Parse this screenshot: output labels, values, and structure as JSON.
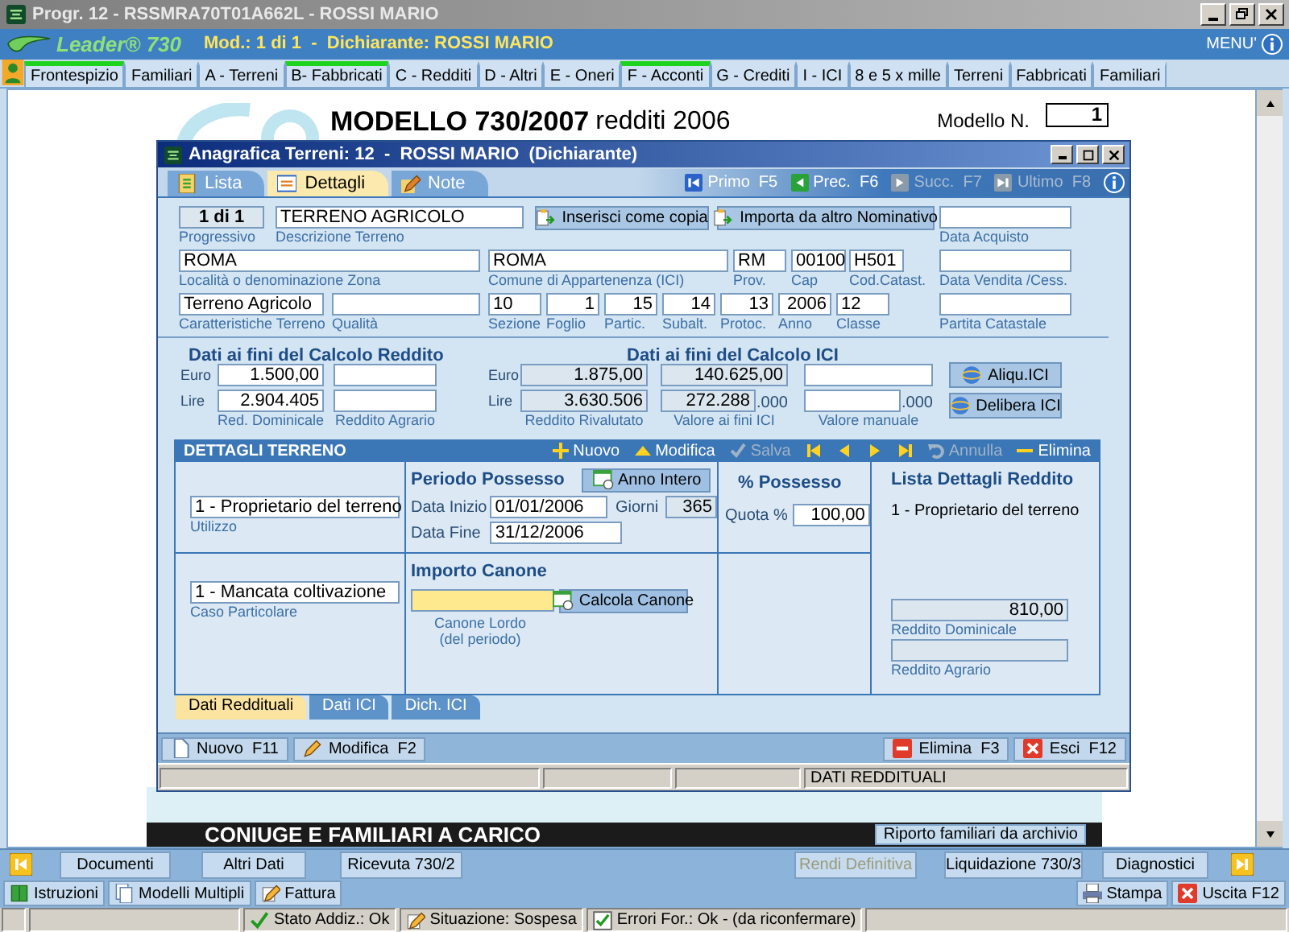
{
  "window": {
    "title": "Progr. 12 - RSSMRA70T01A662L - ROSSI MARIO"
  },
  "header": {
    "logo": "Leader® 730",
    "info": "Mod.: 1 di 1  -  Dichiarante: ROSSI MARIO",
    "menu": "MENU'"
  },
  "main_tabs": [
    {
      "label": "Frontespizio",
      "flagged": true
    },
    {
      "label": "Familiari",
      "flagged": false
    },
    {
      "label": "A - Terreni",
      "flagged": false
    },
    {
      "label": "B- Fabbricati",
      "flagged": true
    },
    {
      "label": "C - Redditi",
      "flagged": false
    },
    {
      "label": "D - Altri",
      "flagged": false
    },
    {
      "label": "E - Oneri",
      "flagged": false
    },
    {
      "label": "F - Acconti",
      "flagged": true
    },
    {
      "label": "G - Crediti",
      "flagged": false
    },
    {
      "label": "I - ICI",
      "flagged": false
    },
    {
      "label": "8 e 5 x mille",
      "flagged": false
    },
    {
      "label": "Terreni",
      "flagged": false
    },
    {
      "label": "Fabbricati",
      "flagged": false
    },
    {
      "label": "Familiari",
      "flagged": false
    }
  ],
  "document": {
    "title": "MODELLO 730/2007",
    "subtitle": "redditi 2006",
    "number_label": "Modello N.",
    "number": "1",
    "section_title": "CONIUGE E FAMILIARI A CARICO",
    "section_button": "Riporto familiari da archivio"
  },
  "dialog": {
    "title": "Anagrafica Terreni: 12  -  ROSSI MARIO  (Dichiarante)",
    "tabs": [
      {
        "label": "Lista",
        "selected": false
      },
      {
        "label": "Dettagli",
        "selected": true
      },
      {
        "label": "Note",
        "selected": false
      }
    ],
    "record_nav": [
      {
        "kind": "first",
        "label": "Primo  F5",
        "disabled": false
      },
      {
        "kind": "prev",
        "label": "Prec.  F6",
        "disabled": false
      },
      {
        "kind": "next",
        "label": "Succ.  F7",
        "disabled": true
      },
      {
        "kind": "last",
        "label": "Ultimo  F8",
        "disabled": true
      }
    ],
    "fields": [
      {
        "kind": "counter",
        "value": "1 di 1",
        "label": "Progressivo"
      },
      {
        "kind": "text",
        "value": "TERRENO AGRICOLO",
        "label": "Descrizione Terreno"
      },
      {
        "kind": "button",
        "label": "Inserisci come copia"
      },
      {
        "kind": "button",
        "label": "Importa da altro Nominativo"
      },
      {
        "kind": "text",
        "label": "Data Acquisto"
      },
      {
        "kind": "text",
        "value": "ROMA",
        "label": "Località o denominazione Zona"
      },
      {
        "kind": "text",
        "value": "ROMA",
        "label": "Comune di Appartenenza (ICI)"
      },
      {
        "kind": "text",
        "value": "RM",
        "label": "Prov."
      },
      {
        "kind": "text",
        "value": "00100",
        "label": "Cap"
      },
      {
        "kind": "text",
        "value": "H501",
        "label": "Cod.Catast."
      },
      {
        "kind": "text",
        "label": "Data Vendita /Cess."
      },
      {
        "kind": "text",
        "value": "Terreno Agricolo",
        "label": "Caratteristiche Terreno"
      },
      {
        "kind": "text",
        "label": "Qualità"
      },
      {
        "kind": "text",
        "value": "10",
        "label": "Sezione"
      },
      {
        "kind": "number",
        "value": "1",
        "label": "Foglio"
      },
      {
        "kind": "number",
        "value": "15",
        "label": "Partic."
      },
      {
        "kind": "number",
        "value": "14",
        "label": "Subalt."
      },
      {
        "kind": "number",
        "value": "13",
        "label": "Protoc."
      },
      {
        "kind": "number",
        "value": "2006",
        "label": "Anno"
      },
      {
        "kind": "text",
        "value": "12",
        "label": "Classe"
      },
      {
        "kind": "text",
        "label": "Partita Catastale"
      }
    ],
    "reddito": {
      "title": "Dati ai fini del Calcolo Reddito",
      "euro_label": "Euro",
      "lire_label": "Lire",
      "columns": [
        {
          "kind": "number",
          "euro": "1.500,00",
          "lire": "2.904.405",
          "label": "Red. Dominicale"
        },
        {
          "kind": "number",
          "label": "Reddito Agrario"
        }
      ]
    },
    "ici": {
      "title": "Dati ai fini del Calcolo ICI",
      "euro_label": "Euro",
      "lire_label": "Lire",
      "columns": [
        {
          "kind": "readonly",
          "euro": "1.875,00",
          "lire": "3.630.506",
          "label": "Reddito Rivalutato"
        },
        {
          "kind": "readonly",
          "euro": "140.625,00",
          "lire": "272.288",
          "lire_suffix": ".000",
          "label": "Valore ai fini ICI"
        },
        {
          "kind": "number",
          "lire_suffix": ".000",
          "label": "Valore manuale"
        }
      ],
      "buttons": [
        "Aliqu.ICI",
        "Delibera ICI"
      ]
    },
    "details": {
      "title": "DETTAGLI TERRENO",
      "actions": [
        {
          "kind": "add",
          "label": "Nuovo",
          "disabled": false
        },
        {
          "kind": "edit",
          "label": "Modifica",
          "disabled": false
        },
        {
          "kind": "save",
          "label": "Salva",
          "disabled": true
        },
        {
          "kind": "first",
          "disabled": false
        },
        {
          "kind": "prev",
          "disabled": false
        },
        {
          "kind": "next",
          "disabled": false
        },
        {
          "kind": "last",
          "disabled": false
        },
        {
          "kind": "undo",
          "label": "Annulla",
          "disabled": true
        },
        {
          "kind": "delete",
          "label": "Elimina",
          "disabled": false
        }
      ],
      "utilizzo": {
        "value": "1 - Proprietario del terreno",
        "label": "Utilizzo"
      },
      "caso": {
        "value": "1 - Mancata coltivazione",
        "label": "Caso Particolare"
      },
      "periodo": {
        "title": "Periodo Possesso",
        "button": "Anno Intero",
        "start_label": "Data Inizio",
        "start": "01/01/2006",
        "days_label": "Giorni",
        "days": "365",
        "end_label": "Data Fine",
        "end": "31/12/2006"
      },
      "canone": {
        "title": "Importo Canone",
        "button": "Calcola Canone",
        "label_1": "Canone Lordo",
        "label_2": "(del periodo)"
      },
      "possesso": {
        "title": "% Possesso",
        "quota_label": "Quota %",
        "quota": "100,00"
      },
      "lista": {
        "title": "Lista Dettagli Reddito",
        "items": [
          "1 - Proprietario del terreno"
        ],
        "dominicale": "810,00",
        "dominicale_label": "Reddito Dominicale",
        "agrario_label": "Reddito Agrario"
      }
    },
    "bottom_tabs": [
      {
        "label": "Dati Reddituali",
        "selected": true
      },
      {
        "label": "Dati ICI",
        "selected": false
      },
      {
        "label": "Dich. ICI",
        "selected": false
      }
    ],
    "footer_left": [
      {
        "kind": "new",
        "label": "Nuovo  F11"
      },
      {
        "kind": "edit",
        "label": "Modifica  F2"
      }
    ],
    "footer_right": [
      {
        "kind": "delete",
        "label": "Elimina  F3"
      },
      {
        "kind": "close",
        "label": "Esci  F12"
      }
    ],
    "status_text": "DATI REDDITUALI"
  },
  "nav_buttons": [
    {
      "label": "Documenti",
      "disabled": false
    },
    {
      "label": "Altri Dati",
      "disabled": false
    },
    {
      "label": "Ricevuta 730/2",
      "disabled": false
    },
    {
      "label": "Rendi Definitiva",
      "disabled": true
    },
    {
      "label": "Liquidazione 730/3",
      "disabled": false
    },
    {
      "label": "Diagnostici",
      "disabled": false
    }
  ],
  "toolbar_left": [
    {
      "kind": "book",
      "label": "Istruzioni"
    },
    {
      "kind": "pages",
      "label": "Modelli Multipli"
    },
    {
      "kind": "pencil",
      "label": "Fattura"
    }
  ],
  "toolbar_right": [
    {
      "kind": "printer",
      "label": "Stampa"
    },
    {
      "kind": "close",
      "label": "Uscita F12"
    }
  ],
  "status_bar": [
    {
      "kind": "ok",
      "text": "Stato Addiz.: Ok"
    },
    {
      "kind": "pencil",
      "text": "Situazione: Sospesa"
    },
    {
      "kind": "check",
      "text": "Errori For.: Ok - (da riconfermare)"
    }
  ]
}
